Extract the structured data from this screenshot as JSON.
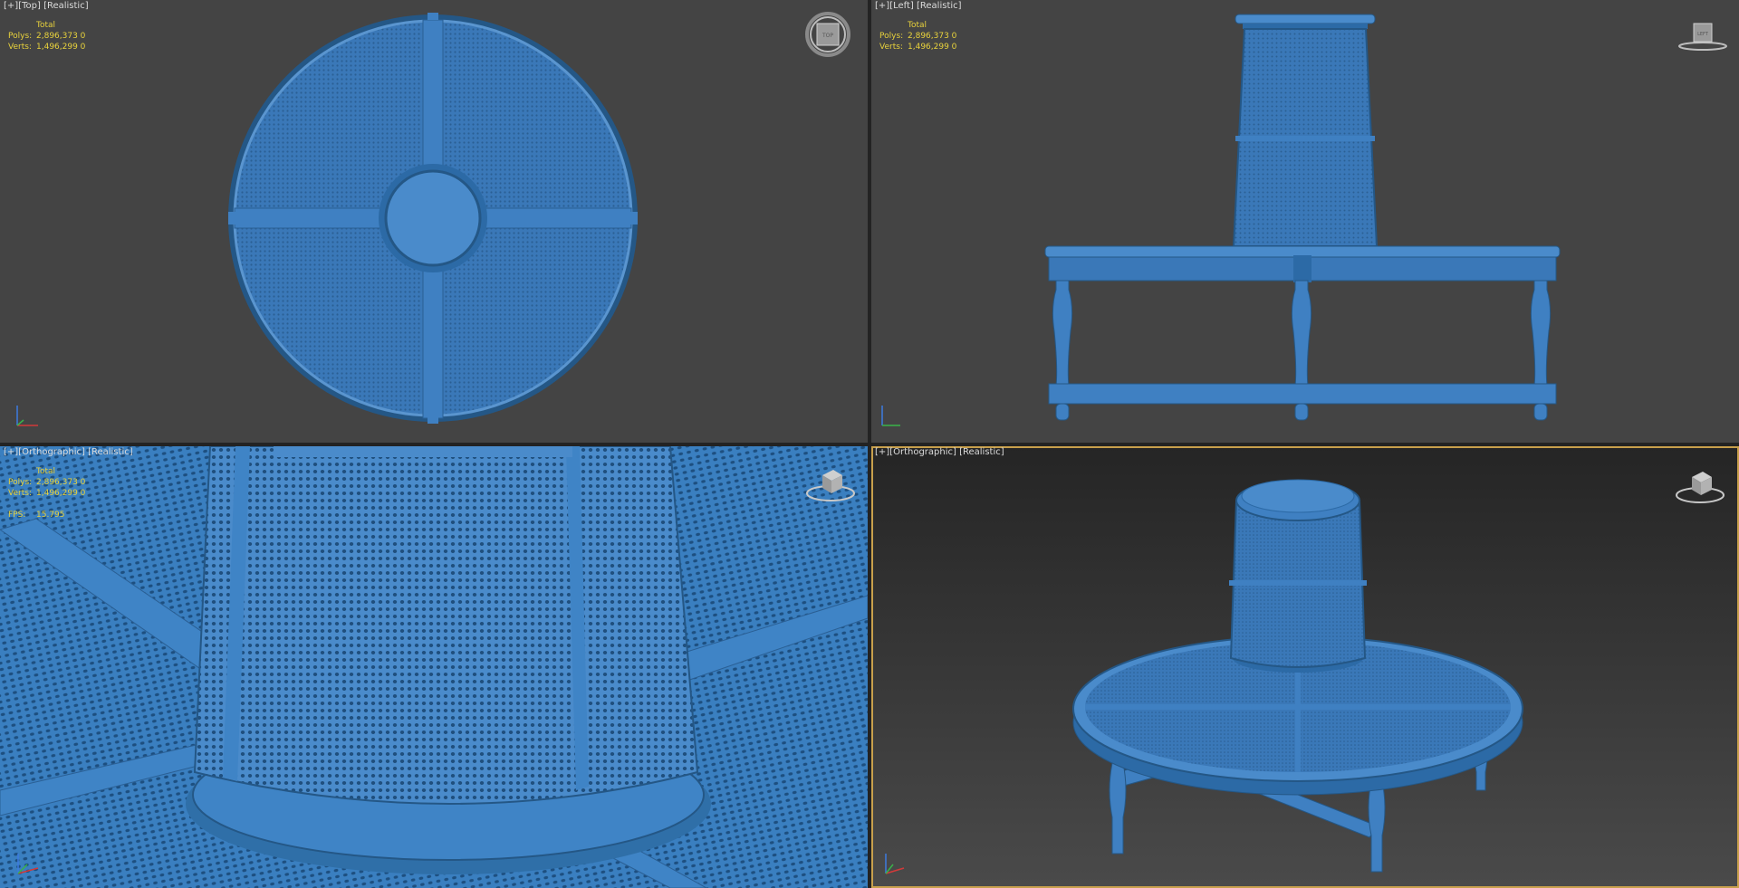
{
  "viewports": {
    "top": {
      "label_plus": "[+]",
      "label_view": "[Top]",
      "label_shading": "[Realistic]",
      "navcube_face": "TOP",
      "stats": {
        "header": "Total",
        "polys_label": "Polys:",
        "polys_value": "2,896,373 0",
        "verts_label": "Verts:",
        "verts_value": "1,496,299 0"
      }
    },
    "left": {
      "label_plus": "[+]",
      "label_view": "[Left]",
      "label_shading": "[Realistic]",
      "navcube_face": "LEFT",
      "stats": {
        "header": "Total",
        "polys_label": "Polys:",
        "polys_value": "2,896,373 0",
        "verts_label": "Verts:",
        "verts_value": "1,496,299 0"
      }
    },
    "perspective": {
      "label_plus": "[+]",
      "label_view": "[Orthographic]",
      "label_shading": "[Realistic]",
      "stats": {
        "header": "Total",
        "polys_label": "Polys:",
        "polys_value": "2,896,373 0",
        "verts_label": "Verts:",
        "verts_value": "1,496,299 0",
        "fps_label": "FPS:",
        "fps_value": "15.795"
      }
    },
    "orthographic": {
      "label_plus": "[+]",
      "label_view": "[Orthographic]",
      "label_shading": "[Realistic]",
      "active": true
    }
  },
  "colors": {
    "viewport_bg": "#444444",
    "model_blue": "#3a78b8",
    "model_dark": "#245786",
    "stats_text": "#e8d23c",
    "active_border": "#c8a04c"
  },
  "icons": {
    "navcube": "viewcube-icon",
    "axis": "axis-tripod-icon"
  }
}
